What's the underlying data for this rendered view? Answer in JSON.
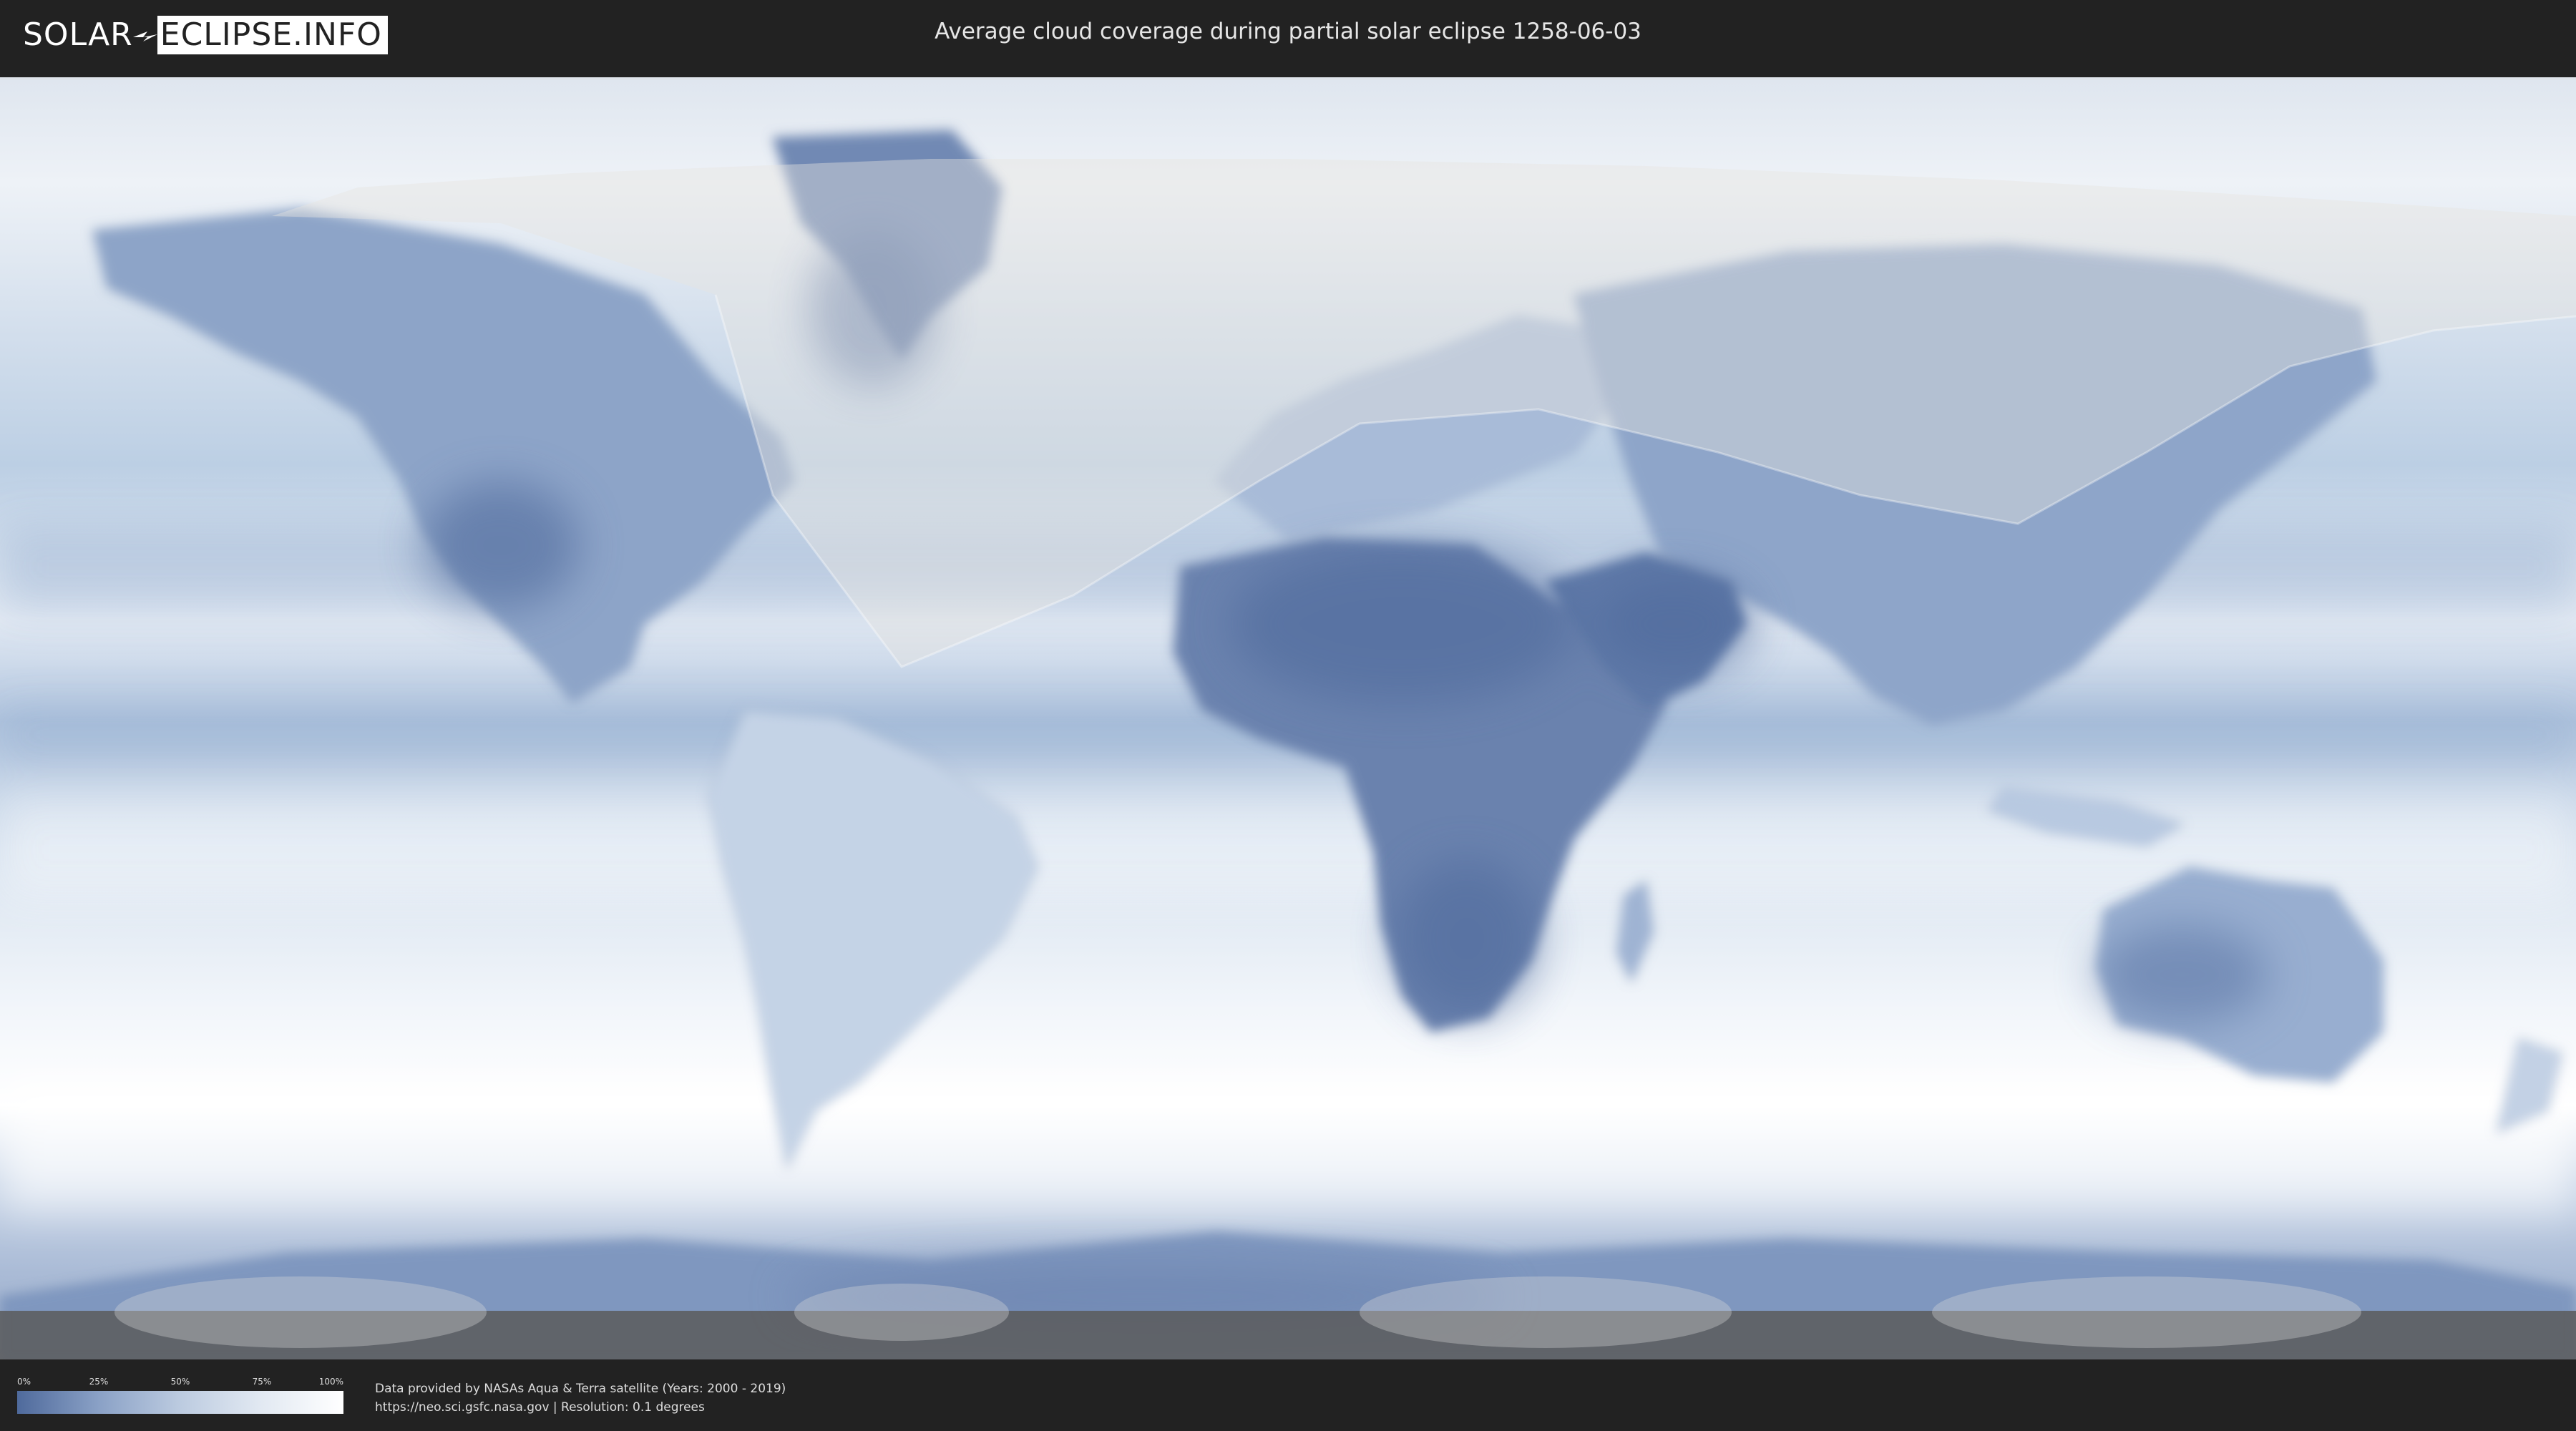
{
  "header": {
    "logo_left": "SOLAR",
    "logo_right": "ECLIPSE.INFO",
    "title": "Average cloud coverage during partial solar eclipse 1258-06-03"
  },
  "legend": {
    "ticks": [
      "0%",
      "25%",
      "50%",
      "75%",
      "100%"
    ],
    "color_low": "#4f6a9c",
    "color_high": "#ffffff"
  },
  "credits": {
    "line1": "Data provided by NASAs Aqua & Terra satellite (Years: 2000 - 2019)",
    "line2": "https://neo.sci.gsfc.nasa.gov | Resolution: 0.1 degrees"
  },
  "colors": {
    "background": "#222222",
    "cloud_dense": "#f5f8fb",
    "cloud_sparse": "#5571a3",
    "eclipse_zone": "#dcdad6"
  }
}
